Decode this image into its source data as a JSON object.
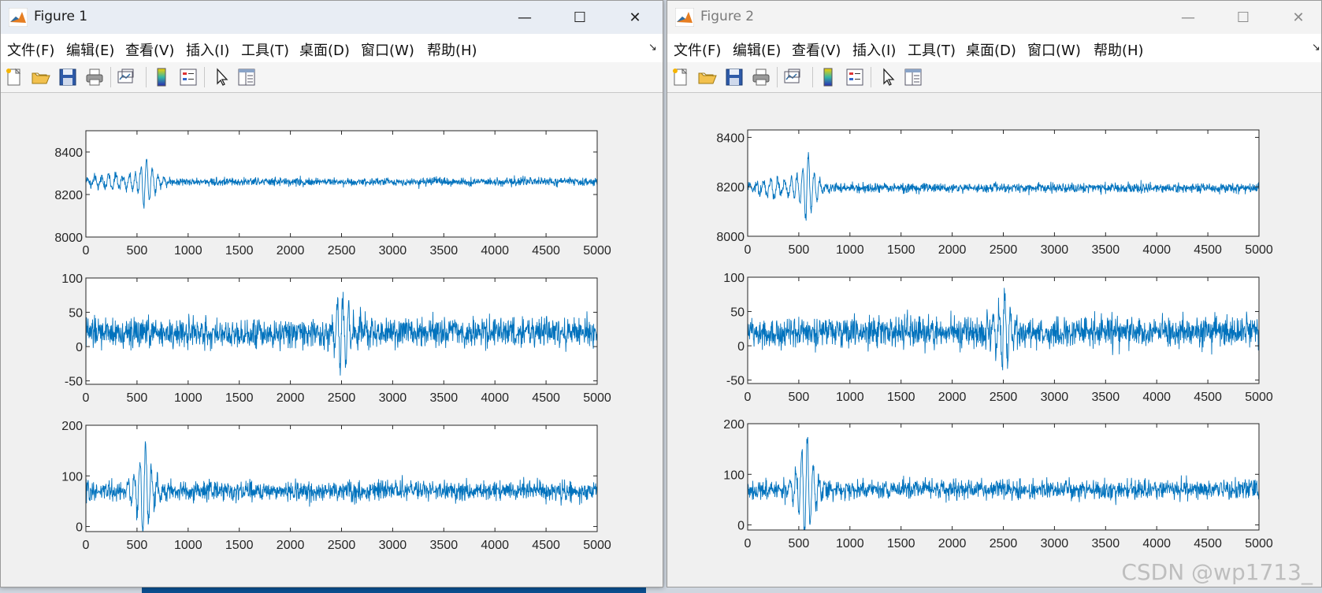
{
  "figures": [
    {
      "title": "Figure 1",
      "active": true,
      "window_controls": {
        "minimize": "—",
        "maximize": "☐",
        "close": "✕"
      },
      "menu": [
        "文件(F)",
        "编辑(E)",
        "查看(V)",
        "插入(I)",
        "工具(T)",
        "桌面(D)",
        "窗口(W)",
        "帮助(H)"
      ],
      "menu_arrow": "↘",
      "toolbar_icons": [
        "new-figure-icon",
        "open-file-icon",
        "save-icon",
        "print-icon",
        "link-plot-icon",
        "colorbar-icon",
        "legend-icon",
        "select-pointer-icon",
        "property-inspector-icon"
      ]
    },
    {
      "title": "Figure 2",
      "active": false,
      "window_controls": {
        "minimize": "—",
        "maximize": "☐",
        "close": "✕"
      },
      "menu": [
        "文件(F)",
        "编辑(E)",
        "查看(V)",
        "插入(I)",
        "工具(T)",
        "桌面(D)",
        "窗口(W)",
        "帮助(H)"
      ],
      "menu_arrow": "↘",
      "toolbar_icons": [
        "new-figure-icon",
        "open-file-icon",
        "save-icon",
        "print-icon",
        "link-plot-icon",
        "colorbar-icon",
        "legend-icon",
        "select-pointer-icon",
        "property-inspector-icon"
      ]
    }
  ],
  "chart_data": [
    {
      "figure": "Figure 1",
      "type": "line",
      "color": "#0072BD",
      "xlim": [
        0,
        5000
      ],
      "ylim": [
        8000,
        8500
      ],
      "xticks": [
        0,
        500,
        1000,
        1500,
        2000,
        2500,
        3000,
        3500,
        4000,
        4500,
        5000
      ],
      "yticks": [
        8000,
        8200,
        8400
      ],
      "baseline": 8260,
      "noise_amplitude": 25,
      "transient": {
        "x": 580,
        "amplitude": 140
      }
    },
    {
      "figure": "Figure 1",
      "type": "line",
      "color": "#0072BD",
      "xlim": [
        0,
        5000
      ],
      "ylim": [
        -55,
        100
      ],
      "xticks": [
        0,
        500,
        1000,
        1500,
        2000,
        2500,
        3000,
        3500,
        4000,
        4500,
        5000
      ],
      "yticks": [
        -50,
        0,
        50,
        100
      ],
      "baseline": 20,
      "noise_amplitude": 28,
      "transient": {
        "x": 2500,
        "amplitude": 60
      }
    },
    {
      "figure": "Figure 1",
      "type": "line",
      "color": "#0072BD",
      "xlim": [
        0,
        5000
      ],
      "ylim": [
        -10,
        200
      ],
      "xticks": [
        0,
        500,
        1000,
        1500,
        2000,
        2500,
        3000,
        3500,
        4000,
        4500,
        5000
      ],
      "yticks": [
        0,
        100,
        200
      ],
      "baseline": 70,
      "noise_amplitude": 25,
      "transient": {
        "x": 570,
        "amplitude": 100
      }
    },
    {
      "figure": "Figure 2",
      "type": "line",
      "color": "#0072BD",
      "xlim": [
        0,
        5000
      ],
      "ylim": [
        8000,
        8430
      ],
      "xticks": [
        0,
        500,
        1000,
        1500,
        2000,
        2500,
        3000,
        3500,
        4000,
        4500,
        5000
      ],
      "yticks": [
        8000,
        8200,
        8400
      ],
      "baseline": 8195,
      "noise_amplitude": 25,
      "transient": {
        "x": 580,
        "amplitude": 160
      }
    },
    {
      "figure": "Figure 2",
      "type": "line",
      "color": "#0072BD",
      "xlim": [
        0,
        5000
      ],
      "ylim": [
        -55,
        100
      ],
      "xticks": [
        0,
        500,
        1000,
        1500,
        2000,
        2500,
        3000,
        3500,
        4000,
        4500,
        5000
      ],
      "yticks": [
        -50,
        0,
        50,
        100
      ],
      "baseline": 20,
      "noise_amplitude": 28,
      "transient": {
        "x": 2500,
        "amplitude": 60
      }
    },
    {
      "figure": "Figure 2",
      "type": "line",
      "color": "#0072BD",
      "xlim": [
        0,
        5000
      ],
      "ylim": [
        -10,
        200
      ],
      "xticks": [
        0,
        500,
        1000,
        1500,
        2000,
        2500,
        3000,
        3500,
        4000,
        4500,
        5000
      ],
      "yticks": [
        0,
        100,
        200
      ],
      "baseline": 70,
      "noise_amplitude": 25,
      "transient": {
        "x": 570,
        "amplitude": 110
      }
    }
  ],
  "watermark": "CSDN @wp1713_"
}
